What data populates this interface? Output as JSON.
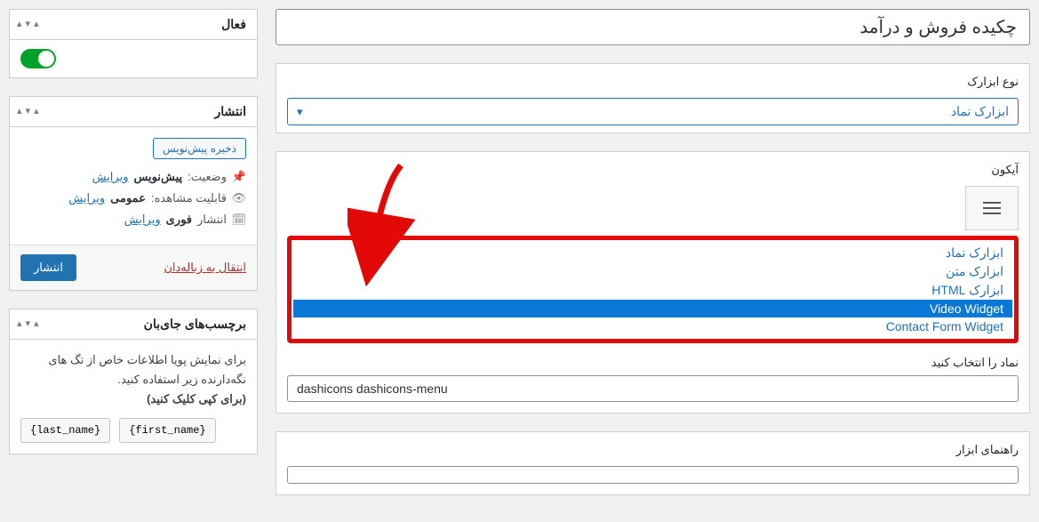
{
  "title": {
    "value": "چکیده فروش و درآمد"
  },
  "widget_type": {
    "label": "نوع ابزارک",
    "selected": "ابزارک نماد",
    "options": [
      "ابزارک نماد",
      "ابزارک متن",
      "ابزارک HTML",
      "Video Widget",
      "Contact Form Widget"
    ],
    "highlighted_index": 3
  },
  "icon_section": {
    "heading": "آیکون",
    "field_label": "نماد را انتخاب کنید",
    "field_value": "dashicons dashicons-menu"
  },
  "guide": {
    "heading": "راهنمای ابزار"
  },
  "active_box": {
    "heading": "فعال"
  },
  "publish": {
    "heading": "انتشار",
    "save_draft_label": "ذخیره پیش‌نویس",
    "status_label": "وضعیت:",
    "status_value": "پیش‌نویس",
    "visibility_label": "قابلیت مشاهده:",
    "visibility_value": "عمومی",
    "schedule_label": "انتشار",
    "schedule_value": "فوری",
    "edit_label": "ویرایش",
    "trash_label": "انتقال به زباله‌دان",
    "submit_label": "انتشار"
  },
  "placeholders": {
    "heading": "برچسب‌های جای‌بان",
    "help_text": "برای نمایش پویا اطلاعات خاص از تگ های نگه‌دارنده زیر استفاده کنید.",
    "help_bold": "(برای کپی کلیک کنید)",
    "tags": [
      "{first_name}",
      "{last_name}"
    ]
  }
}
